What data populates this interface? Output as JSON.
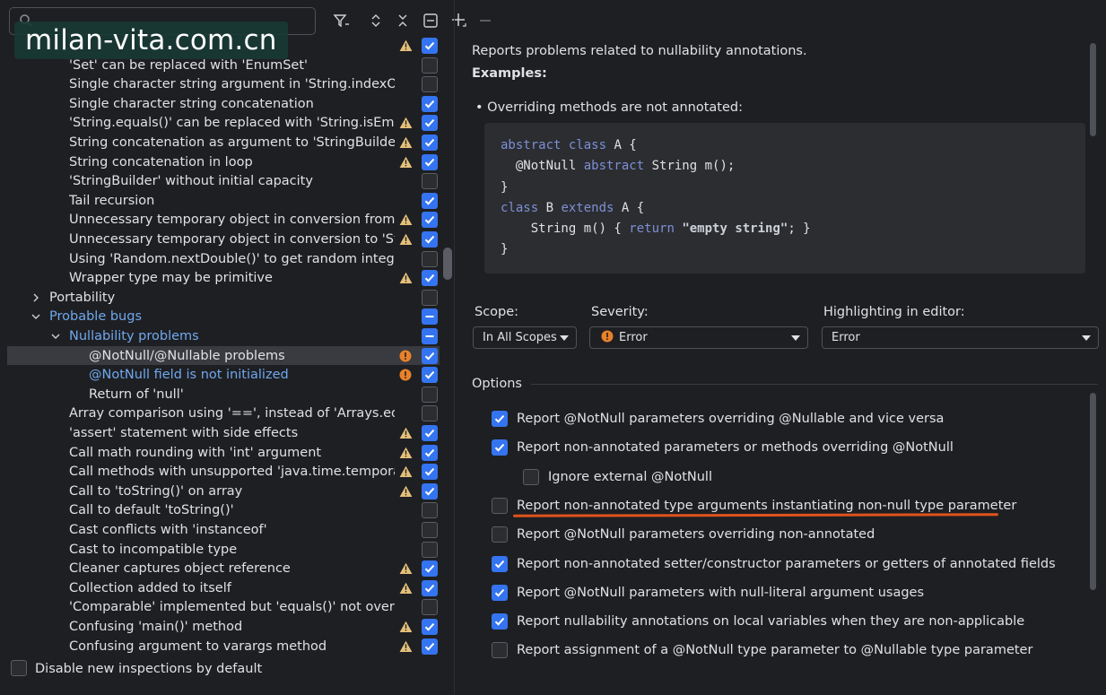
{
  "search": {
    "value": "",
    "placeholder": ""
  },
  "watermark": "milan-vita.com.cn",
  "toolbar": {
    "icons": [
      "filter-icon",
      "expand-icon",
      "collapse-icon",
      "collapse-all-icon",
      "add-icon",
      "remove-icon"
    ]
  },
  "tree": [
    {
      "label": "",
      "indent": 3,
      "warn": true,
      "checked": true
    },
    {
      "label": "'Set' can be replaced with 'EnumSet'",
      "indent": 3,
      "warn": false,
      "checked": false
    },
    {
      "label": "Single character string argument in 'String.indexOf()'",
      "indent": 3,
      "warn": false,
      "checked": false
    },
    {
      "label": "Single character string concatenation",
      "indent": 3,
      "warn": false,
      "checked": true
    },
    {
      "label": "'String.equals()' can be replaced with 'String.isEmpty",
      "indent": 3,
      "warn": true,
      "checked": true
    },
    {
      "label": "String concatenation as argument to 'StringBuilder.a",
      "indent": 3,
      "warn": true,
      "checked": true
    },
    {
      "label": "String concatenation in loop",
      "indent": 3,
      "warn": true,
      "checked": true
    },
    {
      "label": "'StringBuilder' without initial capacity",
      "indent": 3,
      "warn": false,
      "checked": false
    },
    {
      "label": "Tail recursion",
      "indent": 3,
      "warn": false,
      "checked": true
    },
    {
      "label": "Unnecessary temporary object in conversion from 'S",
      "indent": 3,
      "warn": true,
      "checked": true
    },
    {
      "label": "Unnecessary temporary object in conversion to 'Stri",
      "indent": 3,
      "warn": true,
      "checked": true
    },
    {
      "label": "Using 'Random.nextDouble()' to get random integer",
      "indent": 3,
      "warn": false,
      "checked": false
    },
    {
      "label": "Wrapper type may be primitive",
      "indent": 3,
      "warn": true,
      "checked": true
    },
    {
      "label": "Portability",
      "indent": 2,
      "arrow": "right",
      "warn": false,
      "checked": false
    },
    {
      "label": "Probable bugs",
      "indent": 2,
      "arrow": "down",
      "blue": true,
      "warn": false,
      "checked": "partial"
    },
    {
      "label": "Nullability problems",
      "indent": 3,
      "arrow": "down",
      "blue": true,
      "warn": false,
      "checked": "partial"
    },
    {
      "label": "@NotNull/@Nullable problems",
      "indent": 4,
      "error": true,
      "checked": true,
      "selected": true
    },
    {
      "label": "@NotNull field is not initialized",
      "indent": 4,
      "error": true,
      "blue": true,
      "checked": true
    },
    {
      "label": "Return of 'null'",
      "indent": 4,
      "warn": false,
      "checked": false
    },
    {
      "label": "Array comparison using '==', instead of 'Arrays.equal",
      "indent": 3,
      "warn": false,
      "checked": false
    },
    {
      "label": "'assert' statement with side effects",
      "indent": 3,
      "warn": true,
      "checked": true
    },
    {
      "label": "Call math rounding with 'int' argument",
      "indent": 3,
      "warn": true,
      "checked": true
    },
    {
      "label": "Call methods with unsupported 'java.time.temporal.C",
      "indent": 3,
      "warn": true,
      "checked": true
    },
    {
      "label": "Call to 'toString()' on array",
      "indent": 3,
      "warn": true,
      "checked": true
    },
    {
      "label": "Call to default 'toString()'",
      "indent": 3,
      "warn": false,
      "checked": false
    },
    {
      "label": "Cast conflicts with 'instanceof'",
      "indent": 3,
      "warn": false,
      "checked": false
    },
    {
      "label": "Cast to incompatible type",
      "indent": 3,
      "warn": false,
      "checked": false
    },
    {
      "label": "Cleaner captures object reference",
      "indent": 3,
      "warn": true,
      "checked": true
    },
    {
      "label": "Collection added to itself",
      "indent": 3,
      "warn": true,
      "checked": true
    },
    {
      "label": "'Comparable' implemented but 'equals()' not overrido",
      "indent": 3,
      "warn": false,
      "checked": false
    },
    {
      "label": "Confusing 'main()' method",
      "indent": 3,
      "warn": true,
      "checked": true
    },
    {
      "label": "Confusing argument to varargs method",
      "indent": 3,
      "warn": true,
      "checked": true
    }
  ],
  "footer": {
    "label": "Disable new inspections by default",
    "checked": false
  },
  "description": {
    "text": "Reports problems related to nullability annotations.",
    "examples": "Examples:",
    "bullet": "• Overriding methods are not annotated:"
  },
  "code": [
    [
      {
        "t": "abstract class",
        "k": 1
      },
      {
        "t": " A {"
      }
    ],
    [
      {
        "t": "  @NotNull "
      },
      {
        "t": "abstract",
        "k": 1
      },
      {
        "t": " String m();"
      }
    ],
    [
      {
        "t": "}"
      }
    ],
    [
      {
        "t": "class",
        "k": 1
      },
      {
        "t": " B "
      },
      {
        "t": "extends",
        "k": 1
      },
      {
        "t": " A {"
      }
    ],
    [
      {
        "t": "    String m() { "
      },
      {
        "t": "return",
        "k": 1
      },
      {
        "t": " "
      },
      {
        "t": "\"empty string\"",
        "s": 1
      },
      {
        "t": "; }"
      }
    ],
    [
      {
        "t": "}"
      }
    ]
  ],
  "scope": {
    "label": "Scope:",
    "value": "In All Scopes"
  },
  "severity": {
    "label": "Severity:",
    "value": "Error"
  },
  "highlighting": {
    "label": "Highlighting in editor:",
    "value": "Error"
  },
  "options": {
    "label": "Options",
    "items": [
      {
        "text": "Report @NotNull parameters overriding @Nullable and vice versa",
        "checked": true,
        "indent": 0
      },
      {
        "text": "Report non-annotated parameters or methods overriding @NotNull",
        "checked": true,
        "indent": 0
      },
      {
        "text": "Ignore external @NotNull",
        "checked": false,
        "indent": 1
      },
      {
        "text": "Report non-annotated type arguments instantiating non-null type parameter",
        "checked": false,
        "indent": 0
      },
      {
        "text": "Report @NotNull parameters overriding non-annotated",
        "checked": false,
        "indent": 0
      },
      {
        "text": "Report non-annotated setter/constructor parameters or getters of annotated fields",
        "checked": true,
        "indent": 0
      },
      {
        "text": "Report @NotNull parameters with null-literal argument usages",
        "checked": true,
        "indent": 0
      },
      {
        "text": "Report nullability annotations on local variables when they are non-applicable",
        "checked": true,
        "indent": 0
      },
      {
        "text": "Report assignment of a @NotNull type parameter to @Nullable type parameter",
        "checked": false,
        "indent": 0
      }
    ]
  },
  "colors": {
    "accent": "#3574f0",
    "warning": "#e5c07b",
    "error": "#e8812a",
    "underline": "#e0531c",
    "link": "#6fa8ee"
  }
}
